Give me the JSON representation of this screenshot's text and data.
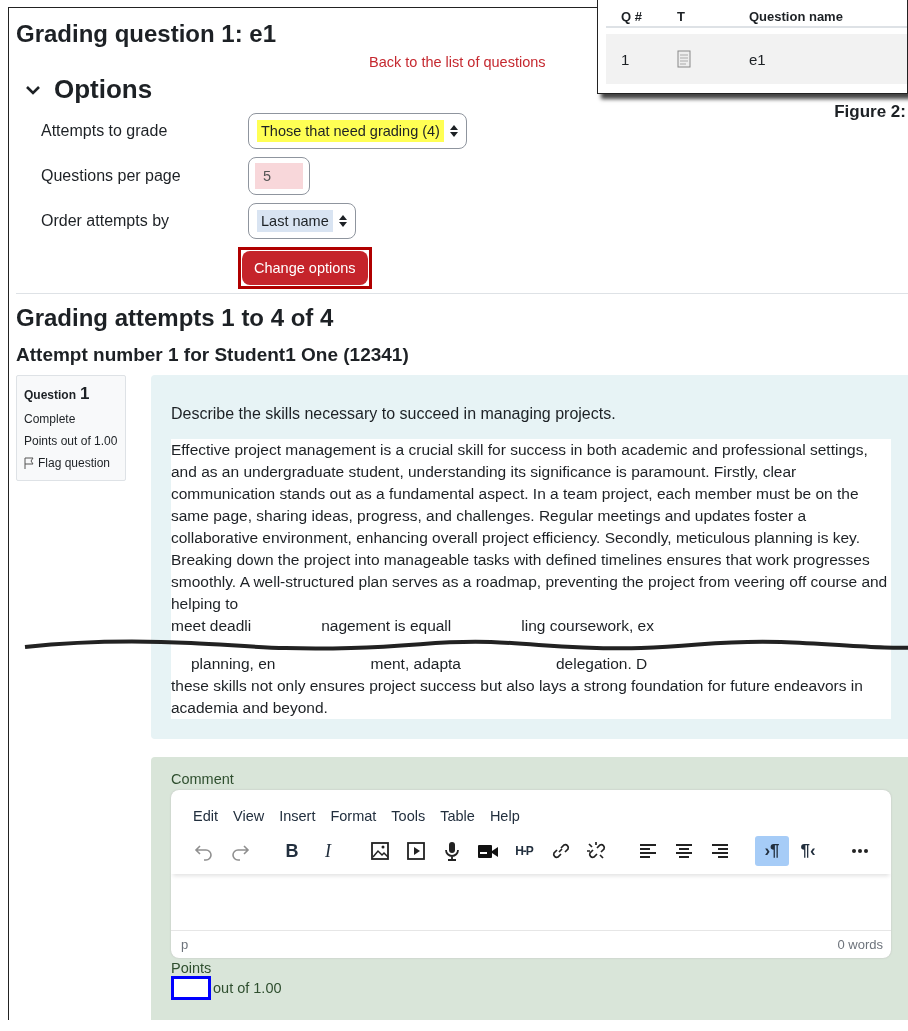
{
  "title": "Grading question 1: e1",
  "back_link": "Back to the list of questions",
  "options": {
    "heading": "Options",
    "expanded": true,
    "fields": [
      {
        "label": "Attempts to grade",
        "kind": "select",
        "value": "Those that need grading (4)",
        "color": "#ffff54"
      },
      {
        "label": "Questions per page",
        "kind": "number",
        "value": "5",
        "color": "#f8d7da"
      },
      {
        "label": "Order attempts by",
        "kind": "select",
        "value": "Last name",
        "color": "#d9e4f2"
      }
    ],
    "button": {
      "label": "Change options",
      "outlined": true
    }
  },
  "attempts_heading": "Grading attempts 1 to 4 of 4",
  "attempt_heading": "Attempt number 1 for Student1 One (12341)",
  "question": {
    "label": "Question",
    "number": "1",
    "status": "Complete",
    "points": "Points out of 1.00",
    "flag": "Flag question",
    "prompt": "Describe the skills necessary to succeed in managing projects.",
    "answer_before": "Effective project management is a crucial skill for success in both academic and professional settings, and as an undergraduate student, understanding its significance is paramount. Firstly, clear communication stands out as a fundamental aspect. In a team project, each member must be on the same page, sharing ideas, progress, and challenges. Regular meetings and updates foster a collaborative environment, enhancing overall project efficiency. Secondly, meticulous planning is key. Breaking down the project into manageable tasks with defined timelines ensures that work progresses smoothly. A well-structured plan serves as a roadmap, preventing the project from veering off course and helping to",
    "torn_top": [
      "meet deadli",
      "nagement is equall",
      "ling coursework, ex"
    ],
    "torn_bottom": [
      "planning, en",
      "ment, adapta",
      "delegation. D"
    ],
    "answer_after": "these skills not only ensures project success but also lays a strong foundation for future endeavors in academia and beyond."
  },
  "comment": {
    "label": "Comment",
    "menu": [
      "Edit",
      "View",
      "Insert",
      "Format",
      "Tools",
      "Table",
      "Help"
    ],
    "toolbar": [
      {
        "kind": "undo",
        "disabled": true,
        "selected": false
      },
      {
        "kind": "redo",
        "disabled": true,
        "selected": false
      },
      {
        "kind": "bold",
        "glyph": "B",
        "disabled": false,
        "selected": false
      },
      {
        "kind": "italic",
        "glyph": "I",
        "disabled": false,
        "selected": false
      },
      {
        "kind": "image",
        "disabled": false,
        "selected": false
      },
      {
        "kind": "media",
        "disabled": false,
        "selected": false
      },
      {
        "kind": "microphone",
        "disabled": false,
        "selected": false
      },
      {
        "kind": "video",
        "disabled": false,
        "selected": false
      },
      {
        "kind": "logo",
        "glyph": "H-P",
        "disabled": false,
        "selected": false
      },
      {
        "kind": "link",
        "disabled": false,
        "selected": false
      },
      {
        "kind": "unlink",
        "disabled": false,
        "selected": false
      },
      {
        "kind": "align-left",
        "disabled": false,
        "selected": false
      },
      {
        "kind": "align-center",
        "disabled": false,
        "selected": false
      },
      {
        "kind": "align-right",
        "disabled": false,
        "selected": false
      },
      {
        "kind": "ltr",
        "glyph": "›¶",
        "disabled": false,
        "selected": true
      },
      {
        "kind": "rtl",
        "glyph": "¶‹",
        "disabled": false,
        "selected": false
      },
      {
        "kind": "more",
        "disabled": false,
        "selected": false
      }
    ],
    "path": "p",
    "word_count": "0 words",
    "points_label": "Points",
    "points_suffix": "out of 1.00",
    "points_outlined": true
  },
  "figure": {
    "columns": [
      "Q #",
      "T",
      "Question name"
    ],
    "row": {
      "number": "1",
      "name": "e1"
    },
    "caption": "Figure 2:"
  }
}
